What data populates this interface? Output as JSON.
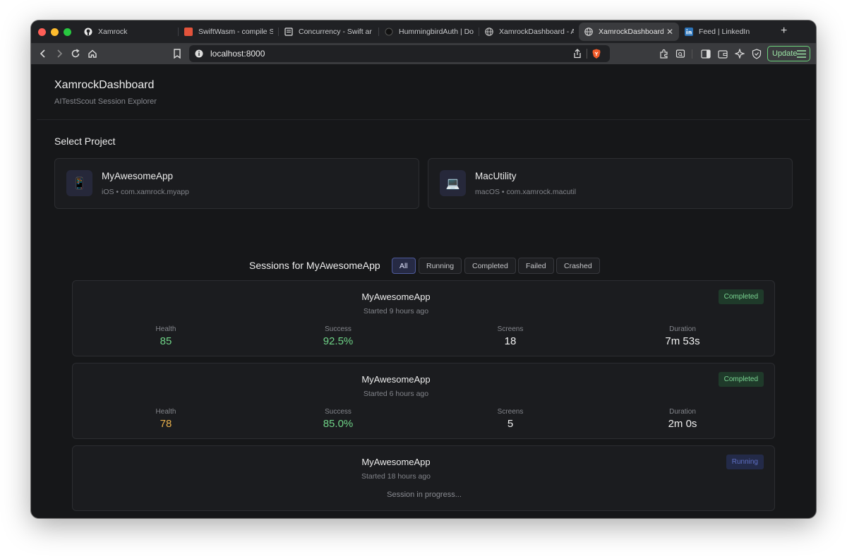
{
  "browser": {
    "tabs": [
      {
        "title": "Xamrock",
        "icon": "github-icon"
      },
      {
        "title": "SwiftWasm - compile S",
        "icon": "swiftwasm-icon"
      },
      {
        "title": "Concurrency - Swift ar",
        "icon": "book-icon"
      },
      {
        "title": "HummingbirdAuth | Doc",
        "icon": "globe-icon"
      },
      {
        "title": "XamrockDashboard - A",
        "icon": "globe-icon"
      },
      {
        "title": "XamrockDashboard",
        "icon": "globe-icon",
        "active": true
      },
      {
        "title": "Feed | LinkedIn",
        "icon": "linkedin-icon"
      }
    ],
    "new_tab_label": "+",
    "url": "localhost:8000",
    "update_label": "Update",
    "colors": {
      "close": "#ff5f57",
      "minimize": "#febc2e",
      "maximize": "#28c840"
    }
  },
  "header": {
    "title": "XamrockDashboard",
    "subtitle": "AITestScout Session Explorer"
  },
  "projects": {
    "title": "Select Project",
    "items": [
      {
        "name": "MyAwesomeApp",
        "meta": "iOS • com.xamrock.myapp",
        "icon": "phone-icon",
        "icon_glyph": "📱"
      },
      {
        "name": "MacUtility",
        "meta": "macOS • com.xamrock.macutil",
        "icon": "laptop-icon",
        "icon_glyph": "💻"
      }
    ]
  },
  "sessions": {
    "title": "Sessions for MyAwesomeApp",
    "filters": [
      "All",
      "Running",
      "Completed",
      "Failed",
      "Crashed"
    ],
    "active_filter": "All",
    "labels": {
      "health": "Health",
      "success": "Success",
      "screens": "Screens",
      "duration": "Duration"
    },
    "items": [
      {
        "name": "MyAwesomeApp",
        "started": "Started 9 hours ago",
        "status": "Completed",
        "health": "85",
        "success": "92.5%",
        "screens": "18",
        "duration": "7m 53s",
        "health_color": "#6fd387",
        "success_color": "#6fd387"
      },
      {
        "name": "MyAwesomeApp",
        "started": "Started 6 hours ago",
        "status": "Completed",
        "health": "78",
        "success": "85.0%",
        "screens": "5",
        "duration": "2m 0s",
        "health_color": "#e8b04c",
        "success_color": "#6fd387"
      },
      {
        "name": "MyAwesomeApp",
        "started": "Started 18 hours ago",
        "status": "Running",
        "progress": "Session in progress..."
      }
    ]
  }
}
